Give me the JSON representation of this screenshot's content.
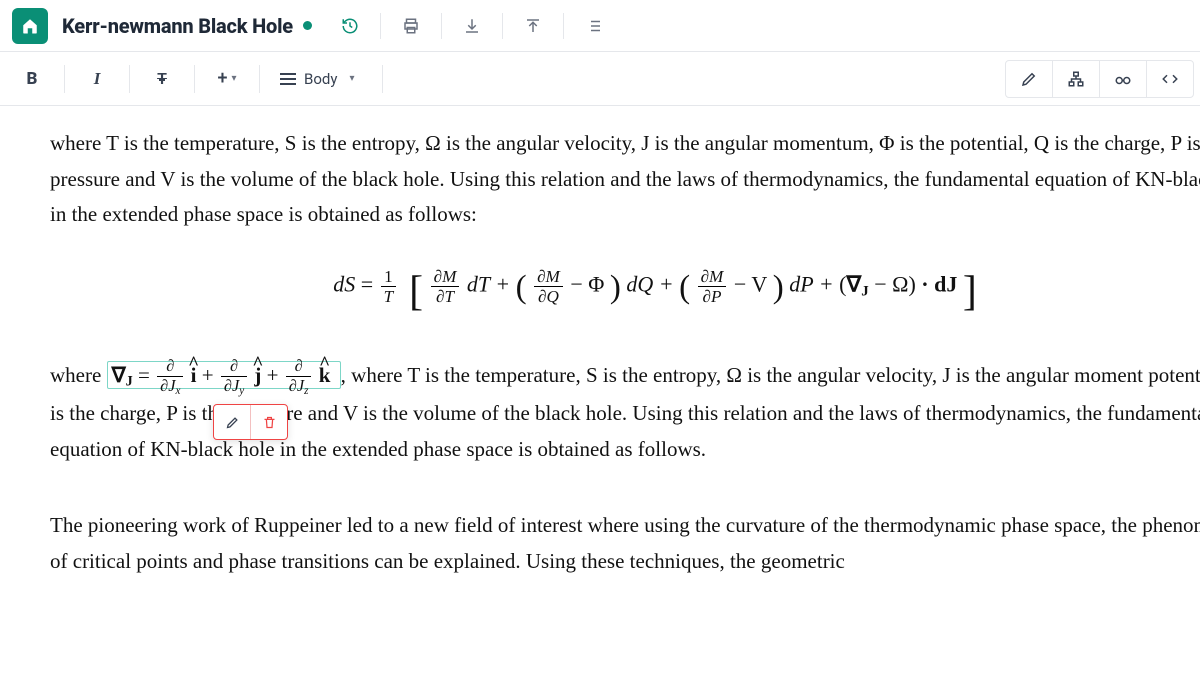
{
  "header": {
    "title": "Kerr-newmann Black Hole"
  },
  "toolbar": {
    "bold": "B",
    "italic": "I",
    "strike": "T",
    "plus": "+",
    "body_label": "Body"
  },
  "content": {
    "para1": "where T is the temperature, S is the entropy, Ω is the angular velocity, J is the angular momentum, Φ is the potential, Q is the charge, P is the pressure and V is the volume of the black hole. Using this relation and the laws of thermodynamics, the fundamental equation of KN-black hole in the extended phase space is obtained as follows:",
    "eq1": {
      "lhs": "dS",
      "eq": " = ",
      "frac_t_num": "1",
      "frac_t_den": "T",
      "dm_dt_num": "∂M",
      "dm_dt_den": "∂T",
      "dT": " dT + ",
      "dm_dq_num": "∂M",
      "dm_dq_den": "∂Q",
      "minus_phi": " − Φ",
      "dQ": " dQ + ",
      "dm_dp_num": "∂M",
      "dm_dp_den": "∂P",
      "minus_v": " − V",
      "dP": " dP + ",
      "nabla": "∇",
      "nabla_sub": "J",
      "minus_omega": " − Ω",
      "dot_dJ": " · dJ"
    },
    "para2_pre": "where ",
    "inline_eq": {
      "nabla": "∇",
      "nabla_sub": "J",
      "eq": " = ",
      "f1_num": "∂",
      "f1_den_a": "∂J",
      "f1_den_b": "x",
      "i": "i",
      "plus1": " + ",
      "f2_num": "∂",
      "f2_den_a": "∂J",
      "f2_den_b": "y",
      "j": "j",
      "plus2": " + ",
      "f3_num": "∂",
      "f3_den_a": "∂J",
      "f3_den_b": "z",
      "k": "k"
    },
    "para2_post": " , where T is the temperature, S is the entropy, Ω is the angular velocity, J is the angular moment           potential, Q is the charge, P is the pressure and V is the volume of the black hole. Using this relation and the laws of thermodynamics, the fundamental equation of KN-black hole in the extended phase space is obtained as follows.",
    "para3": "The pioneering work of Ruppeiner led to a new field of interest where using the curvature of the thermodynamic phase space, the phenomena of critical points and phase transitions can be explained. Using these techniques, the geometric"
  }
}
